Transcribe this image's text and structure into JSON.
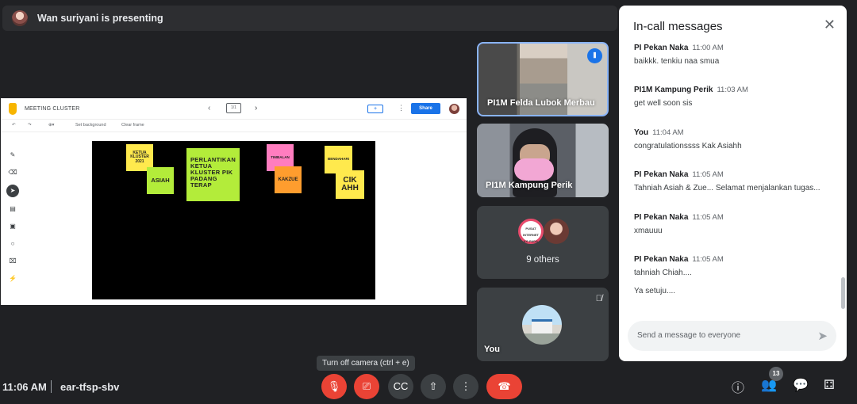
{
  "presenting": {
    "text": "Wan suriyani is presenting"
  },
  "jamboard": {
    "title": "MEETING CLUSTER",
    "frame_indicator": "1/1",
    "share_label": "Share",
    "add_label": "+",
    "toolbar_set_bg": "Set background",
    "toolbar_clear": "Clear frame",
    "notes": [
      {
        "text": "KETUA KLUSTER 2021",
        "color": "#ffe94d"
      },
      {
        "text": "ASIAH",
        "color": "#b3ec3a"
      },
      {
        "text": "PERLANTIKAN KETUA KLUSTER PIK PADANG TERAP",
        "color": "#b3ec3a"
      },
      {
        "text": "TIMBALAN",
        "color": "#ff7dbf"
      },
      {
        "text": "KAKZUE",
        "color": "#ff9d2e"
      },
      {
        "text": "BENDAHARI",
        "color": "#ffe94d"
      },
      {
        "text": "CIK AHH",
        "color": "#ffe94d"
      }
    ]
  },
  "participants": {
    "tile1_name": "PI1M Felda Lubok Merbau",
    "tile2_name": "PI1M Kampung Perik",
    "tile3_avatar_text": "PUSAT INTERNET KG PADA",
    "tile3_others": "9 others",
    "tile4_name": "You"
  },
  "chat": {
    "title": "In-call messages",
    "messages": [
      {
        "sender": "PI Pekan Naka",
        "time": "11:00 AM",
        "text": "baikkk. tenkiu naa smua"
      },
      {
        "sender": "PI1M Kampung Perik",
        "time": "11:03 AM",
        "text": "get well soon sis"
      },
      {
        "sender": "You",
        "time": "11:04 AM",
        "text": "congratulationssss Kak Asiahh"
      },
      {
        "sender": "PI Pekan Naka",
        "time": "11:05 AM",
        "text": "Tahniah Asiah & Zue... Selamat menjalankan tugas..."
      },
      {
        "sender": "PI Pekan Naka",
        "time": "11:05 AM",
        "text": "xmauuu"
      },
      {
        "sender": "PI Pekan Naka",
        "time": "11:05 AM",
        "text": "tahniah Chiah...."
      },
      {
        "sender": "",
        "time": "",
        "text": "Ya setuju...."
      }
    ],
    "input_placeholder": "Send a message to everyone"
  },
  "bottom_bar": {
    "time": "11:06 AM",
    "meeting_code": "ear-tfsp-sbv",
    "tooltip": "Turn off camera (ctrl + e)",
    "participant_count": "13"
  },
  "icons": {
    "mic": "mic-off-icon",
    "camera": "camera-off-icon",
    "captions": "captions-icon",
    "present": "present-icon",
    "more": "more-icon",
    "end": "end-call-icon",
    "info": "info-icon",
    "people": "people-icon",
    "chat": "chat-icon",
    "activities": "activities-icon"
  },
  "colors": {
    "accent": "#1a73e8",
    "end_call": "#ea4335",
    "background": "#202124"
  }
}
